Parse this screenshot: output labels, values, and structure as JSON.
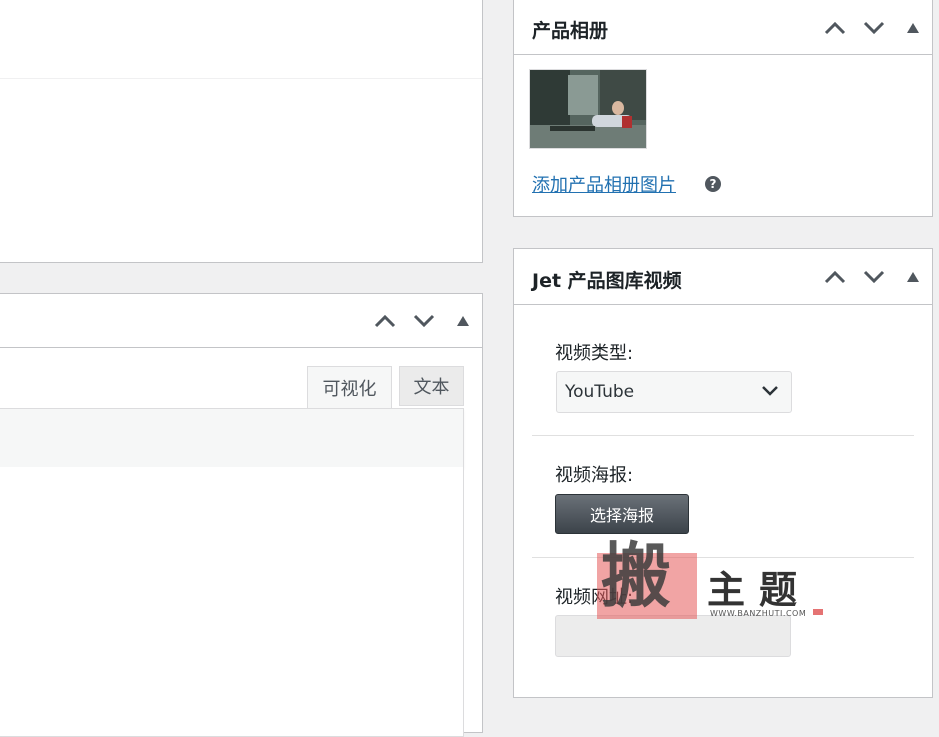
{
  "editor": {
    "tabs": [
      {
        "label": "可视化",
        "active": true
      },
      {
        "label": "文本",
        "active": false
      }
    ]
  },
  "gallery_box": {
    "title": "产品相册",
    "add_link": "添加产品相册图片",
    "help_icon": "?"
  },
  "video_box": {
    "title": "Jet 产品图库视频",
    "type_label": "视频类型:",
    "type_value": "YouTube",
    "poster_label": "视频海报:",
    "poster_button": "选择海报",
    "url_label": "视频网址:",
    "url_value": ""
  },
  "watermark": {
    "seal_char": "搬",
    "title": "主题",
    "url": "WWW.BANZHUTI.COM"
  },
  "colors": {
    "link": "#2271b1",
    "border": "#c3c4c7",
    "button_dark": "#3c434a",
    "watermark_red": "#e57373"
  },
  "icons": [
    "chevron-up-icon",
    "chevron-down-icon",
    "triangle-toggle-icon",
    "help-icon",
    "chevron-down-select-icon"
  ]
}
